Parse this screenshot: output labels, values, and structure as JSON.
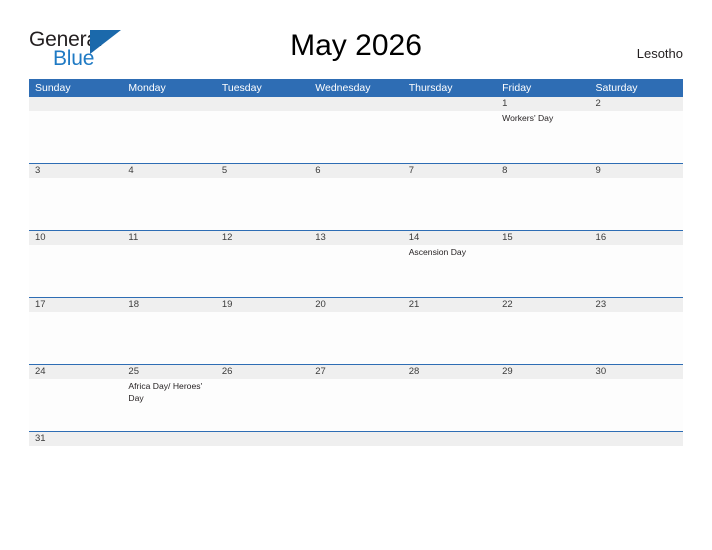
{
  "logo": {
    "word_one": "General",
    "word_two": "Blue",
    "triangle_icon": "blue-triangle-icon",
    "brand_blue": "#1f7ac4",
    "triangle_blue": "#1b69ab"
  },
  "header": {
    "title": "May 2026",
    "locale": "Lesotho"
  },
  "theme": {
    "header_blue": "#2e6db4",
    "band_gray": "#efefef",
    "text_dark": "#231f20"
  },
  "weekdays": [
    "Sunday",
    "Monday",
    "Tuesday",
    "Wednesday",
    "Thursday",
    "Friday",
    "Saturday"
  ],
  "weeks": [
    {
      "days": [
        {
          "num": "",
          "event": ""
        },
        {
          "num": "",
          "event": ""
        },
        {
          "num": "",
          "event": ""
        },
        {
          "num": "",
          "event": ""
        },
        {
          "num": "",
          "event": ""
        },
        {
          "num": "1",
          "event": "Workers' Day"
        },
        {
          "num": "2",
          "event": ""
        }
      ]
    },
    {
      "days": [
        {
          "num": "3",
          "event": ""
        },
        {
          "num": "4",
          "event": ""
        },
        {
          "num": "5",
          "event": ""
        },
        {
          "num": "6",
          "event": ""
        },
        {
          "num": "7",
          "event": ""
        },
        {
          "num": "8",
          "event": ""
        },
        {
          "num": "9",
          "event": ""
        }
      ]
    },
    {
      "days": [
        {
          "num": "10",
          "event": ""
        },
        {
          "num": "11",
          "event": ""
        },
        {
          "num": "12",
          "event": ""
        },
        {
          "num": "13",
          "event": ""
        },
        {
          "num": "14",
          "event": "Ascension Day"
        },
        {
          "num": "15",
          "event": ""
        },
        {
          "num": "16",
          "event": ""
        }
      ]
    },
    {
      "days": [
        {
          "num": "17",
          "event": ""
        },
        {
          "num": "18",
          "event": ""
        },
        {
          "num": "19",
          "event": ""
        },
        {
          "num": "20",
          "event": ""
        },
        {
          "num": "21",
          "event": ""
        },
        {
          "num": "22",
          "event": ""
        },
        {
          "num": "23",
          "event": ""
        }
      ]
    },
    {
      "days": [
        {
          "num": "24",
          "event": ""
        },
        {
          "num": "25",
          "event": "Africa Day/ Heroes' Day"
        },
        {
          "num": "26",
          "event": ""
        },
        {
          "num": "27",
          "event": ""
        },
        {
          "num": "28",
          "event": ""
        },
        {
          "num": "29",
          "event": ""
        },
        {
          "num": "30",
          "event": ""
        }
      ]
    },
    {
      "short": true,
      "days": [
        {
          "num": "31",
          "event": ""
        },
        {
          "num": "",
          "event": ""
        },
        {
          "num": "",
          "event": ""
        },
        {
          "num": "",
          "event": ""
        },
        {
          "num": "",
          "event": ""
        },
        {
          "num": "",
          "event": ""
        },
        {
          "num": "",
          "event": ""
        }
      ]
    }
  ]
}
